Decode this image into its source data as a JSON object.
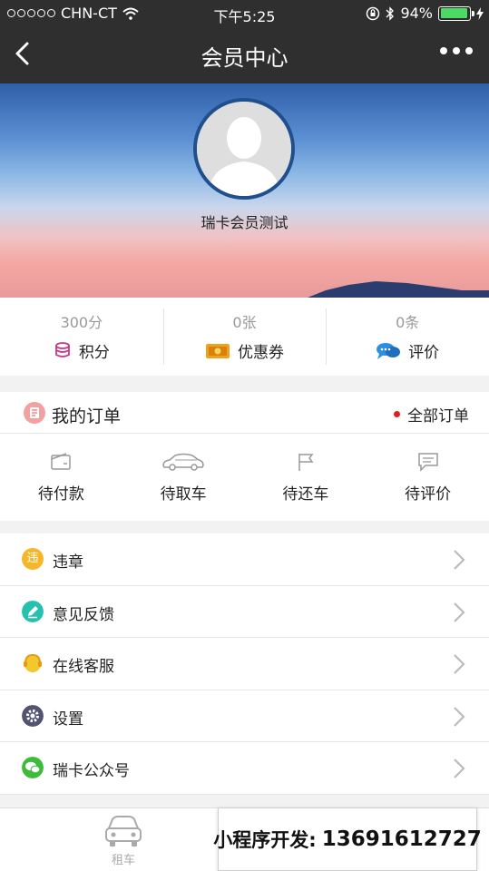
{
  "status": {
    "carrier": "CHN-CT",
    "time": "下午5:25",
    "battery": "94%",
    "battery_level": 0.94
  },
  "nav": {
    "title": "会员中心"
  },
  "profile": {
    "name": "瑞卡会员测试"
  },
  "stats": [
    {
      "value": "300分",
      "label": "积分",
      "icon": "coins-icon"
    },
    {
      "value": "0张",
      "label": "优惠券",
      "icon": "coupon-icon"
    },
    {
      "value": "0条",
      "label": "评价",
      "icon": "chat-bubbles-icon"
    }
  ],
  "orders": {
    "title": "我的订单",
    "all_label": "全部订单",
    "states": [
      {
        "label": "待付款",
        "icon": "wallet-icon"
      },
      {
        "label": "待取车",
        "icon": "car-icon"
      },
      {
        "label": "待还车",
        "icon": "flag-icon"
      },
      {
        "label": "待评价",
        "icon": "comment-icon"
      }
    ]
  },
  "menu": [
    {
      "label": "违章",
      "icon": "violation-icon",
      "color": "#f5b62a",
      "glyph": "违"
    },
    {
      "label": "意见反馈",
      "icon": "pencil-icon",
      "color": "#24c0b0"
    },
    {
      "label": "在线客服",
      "icon": "headset-icon",
      "color": "#f3c82c"
    },
    {
      "label": "设置",
      "icon": "gear-icon",
      "color": "#545472"
    },
    {
      "label": "瑞卡公众号",
      "icon": "wechat-icon",
      "color": "#3dbb3a"
    }
  ],
  "tabbar": {
    "tabs": [
      {
        "label": "租车",
        "icon": "car-icon"
      }
    ]
  },
  "promo": {
    "label": "小程序开发:",
    "phone": "13691612727"
  }
}
